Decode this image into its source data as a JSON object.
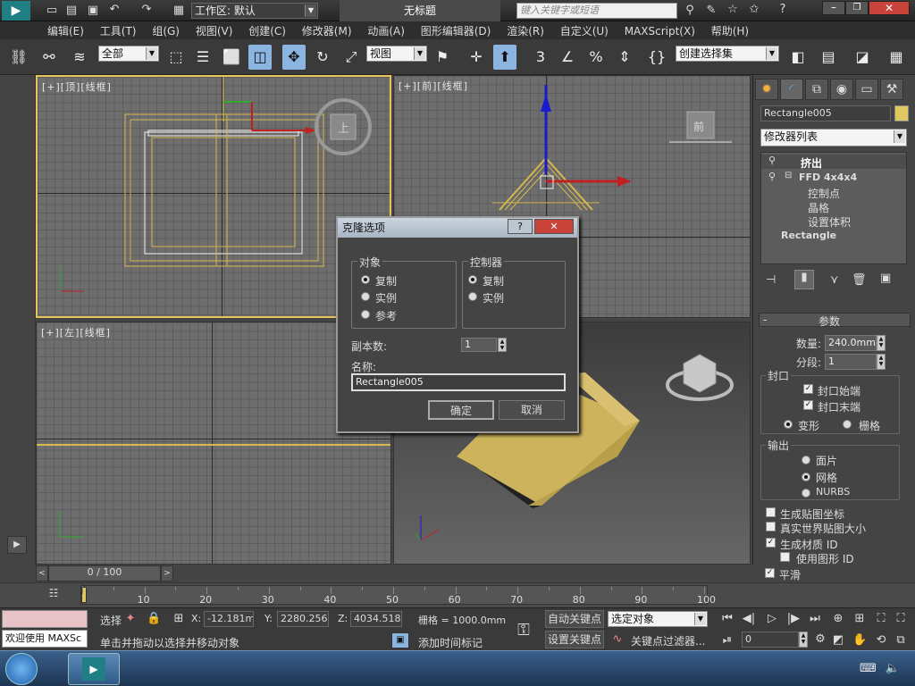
{
  "titlebar": {
    "workspace_label": "工作区: 默认",
    "document_title": "无标题",
    "search_placeholder": "键入关键字或短语"
  },
  "menu": [
    "编辑(E)",
    "工具(T)",
    "组(G)",
    "视图(V)",
    "创建(C)",
    "修改器(M)",
    "动画(A)",
    "图形编辑器(D)",
    "渲染(R)",
    "自定义(U)",
    "MAXScript(X)",
    "帮助(H)"
  ],
  "toolbar": {
    "selection_filter": "全部",
    "ref_coord": "视图",
    "named_selection": "创建选择集"
  },
  "viewports": {
    "top": "[+][顶][线框]",
    "front": "[+][前][线框]",
    "left": "[+][左][线框]",
    "top_cube": "上",
    "front_cube": "前"
  },
  "command_panel": {
    "object_name": "Rectangle005",
    "modifier_list": "修改器列表",
    "stack": [
      "挤出",
      "FFD 4x4x4",
      "控制点",
      "晶格",
      "设置体积",
      "Rectangle"
    ],
    "params_title": "参数",
    "amount_label": "数量:",
    "amount_value": "240.0mm",
    "segments_label": "分段:",
    "segments_value": "1",
    "capping_label": "封口",
    "cap_start": "封口始端",
    "cap_end": "封口末端",
    "morph": "变形",
    "grid": "栅格",
    "output_label": "输出",
    "patch": "面片",
    "mesh": "网格",
    "nurbs": "NURBS",
    "gen_map_coords": "生成贴图坐标",
    "real_world": "真实世界贴图大小",
    "gen_mat_id": "生成材质 ID",
    "use_shape_id": "使用图形 ID",
    "smooth": "平滑"
  },
  "dialog": {
    "title": "克隆选项",
    "object_group": "对象",
    "controller_group": "控制器",
    "copy": "复制",
    "instance": "实例",
    "reference": "参考",
    "ctrl_copy": "复制",
    "ctrl_instance": "实例",
    "copies_label": "副本数:",
    "copies_value": "1",
    "name_label": "名称:",
    "name_value": "Rectangle005",
    "ok": "确定",
    "cancel": "取消",
    "help_glyph": "?",
    "close_glyph": "✕"
  },
  "timeline": {
    "frame": "0 / 100",
    "ticks": [
      "10",
      "20",
      "30",
      "40",
      "50",
      "60",
      "70",
      "80",
      "90",
      "100"
    ],
    "progress": 0
  },
  "status": {
    "welcome": "欢迎使用 MAXSc",
    "select_label": "选择",
    "x_label": "X:",
    "x_value": "-12.181mm",
    "y_label": "Y:",
    "y_value": "2280.256m",
    "z_label": "Z:",
    "z_value": "4034.518m",
    "grid_label": "栅格 = 1000.0mm",
    "hint": "单击并拖动以选择并移动对象",
    "add_time_tag": "添加时间标记",
    "auto_key": "自动关键点",
    "set_key": "设置关键点",
    "selected_obj": "选定对象",
    "key_filters": "关键点过滤器...",
    "frame_value": "0"
  },
  "colors": {
    "accent_blue": "#8cb4e0",
    "object_yellow": "#c8b45a"
  }
}
